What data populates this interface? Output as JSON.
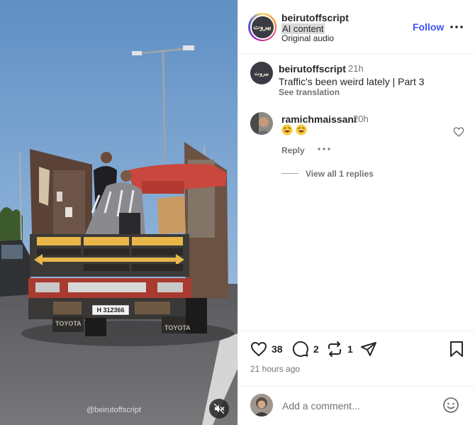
{
  "media": {
    "watermark": "@beirutoffscript",
    "mute_icon": "speaker-muted-icon",
    "plate": "H 312366",
    "brand_left": "TOYOTA",
    "brand_right": "TOYOTA"
  },
  "header": {
    "username": "beirutoffscript",
    "ai_label": "AI content",
    "audio": "Original audio",
    "follow_label": "Follow",
    "more_icon": "more-horizontal-icon",
    "avatar_text": "بيروت"
  },
  "caption": {
    "username": "beirutoffscript",
    "time": "21h",
    "text": "Traffic's been weird lately | Part 3",
    "see_translation": "See translation"
  },
  "comment": {
    "username": "ramichmaissani",
    "time": "20h",
    "emoji_count": 2,
    "reply_label": "Reply",
    "view_replies": "View all 1 replies"
  },
  "actions": {
    "likes": "38",
    "comments": "2",
    "reposts": "1",
    "post_time": "21 hours ago"
  },
  "add_comment": {
    "placeholder": "Add a comment..."
  },
  "colors": {
    "accent": "#4150f7",
    "text": "#262626",
    "secondary": "#737373",
    "border": "#efefef"
  }
}
